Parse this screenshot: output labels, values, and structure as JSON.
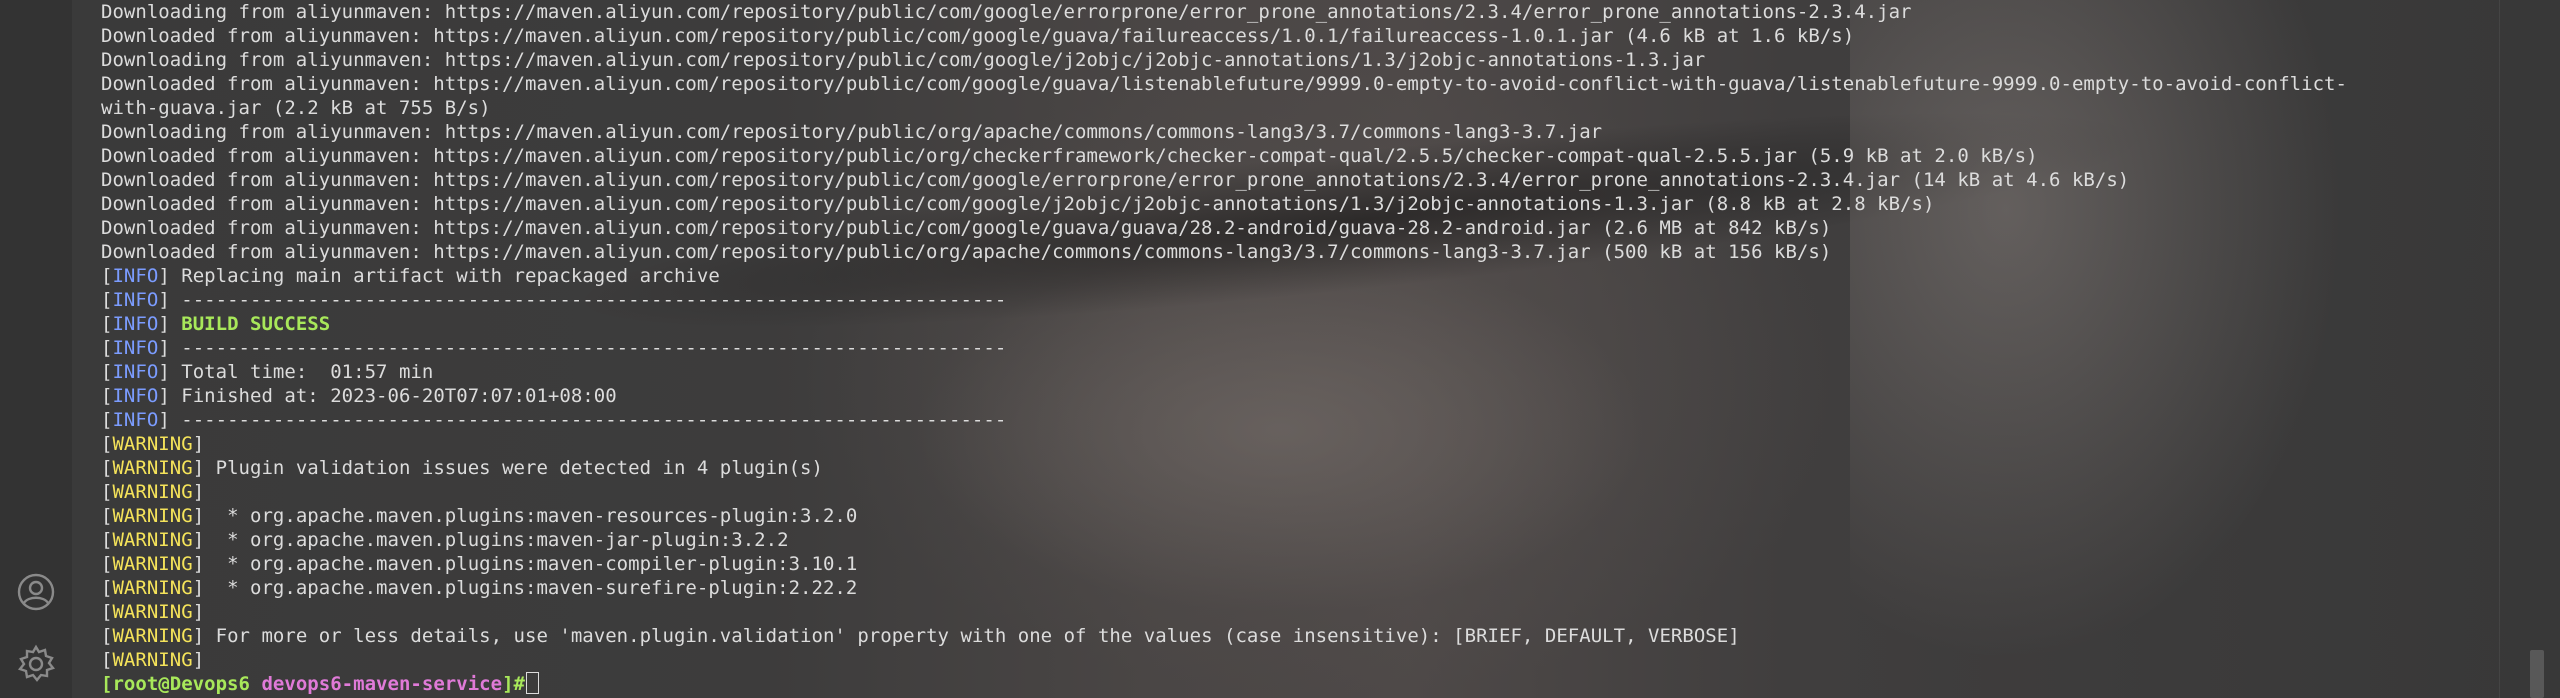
{
  "theme": {
    "info_color": "#7b9cff",
    "warning_color": "#f5e35a",
    "success_color": "#a8e85a",
    "path_color": "#e07ad8",
    "text_color": "#dcdcdc"
  },
  "sidebar": {
    "icons": [
      {
        "name": "user-icon"
      },
      {
        "name": "gear-icon"
      }
    ]
  },
  "terminal": {
    "download_lines": [
      "Downloading from aliyunmaven: https://maven.aliyun.com/repository/public/com/google/errorprone/error_prone_annotations/2.3.4/error_prone_annotations-2.3.4.jar",
      "Downloaded from aliyunmaven: https://maven.aliyun.com/repository/public/com/google/guava/failureaccess/1.0.1/failureaccess-1.0.1.jar (4.6 kB at 1.6 kB/s)",
      "Downloading from aliyunmaven: https://maven.aliyun.com/repository/public/com/google/j2objc/j2objc-annotations/1.3/j2objc-annotations-1.3.jar",
      "Downloaded from aliyunmaven: https://maven.aliyun.com/repository/public/com/google/guava/listenablefuture/9999.0-empty-to-avoid-conflict-with-guava/listenablefuture-9999.0-empty-to-avoid-conflict-",
      "with-guava.jar (2.2 kB at 755 B/s)",
      "Downloading from aliyunmaven: https://maven.aliyun.com/repository/public/org/apache/commons/commons-lang3/3.7/commons-lang3-3.7.jar",
      "Downloaded from aliyunmaven: https://maven.aliyun.com/repository/public/org/checkerframework/checker-compat-qual/2.5.5/checker-compat-qual-2.5.5.jar (5.9 kB at 2.0 kB/s)",
      "Downloaded from aliyunmaven: https://maven.aliyun.com/repository/public/com/google/errorprone/error_prone_annotations/2.3.4/error_prone_annotations-2.3.4.jar (14 kB at 4.6 kB/s)",
      "Downloaded from aliyunmaven: https://maven.aliyun.com/repository/public/com/google/j2objc/j2objc-annotations/1.3/j2objc-annotations-1.3.jar (8.8 kB at 2.8 kB/s)",
      "Downloaded from aliyunmaven: https://maven.aliyun.com/repository/public/com/google/guava/guava/28.2-android/guava-28.2-android.jar (2.6 MB at 842 kB/s)",
      "Downloaded from aliyunmaven: https://maven.aliyun.com/repository/public/org/apache/commons/commons-lang3/3.7/commons-lang3-3.7.jar (500 kB at 156 kB/s)"
    ],
    "info_tag": "INFO",
    "warning_tag": "WARNING",
    "info_lines": {
      "replacing": " Replacing main artifact with repackaged archive",
      "separator": " ------------------------------------------------------------------------",
      "build_success": "BUILD SUCCESS",
      "total_time": " Total time:  01:57 min",
      "finished_at": " Finished at: 2023-06-20T07:07:01+08:00"
    },
    "warning_lines": {
      "plugin_issues": " Plugin validation issues were detected in 4 plugin(s)",
      "plugin_1": "  * org.apache.maven.plugins:maven-resources-plugin:3.2.0",
      "plugin_2": "  * org.apache.maven.plugins:maven-jar-plugin:3.2.2",
      "plugin_3": "  * org.apache.maven.plugins:maven-compiler-plugin:3.10.1",
      "plugin_4": "  * org.apache.maven.plugins:maven-surefire-plugin:2.22.2",
      "details": " For more or less details, use 'maven.plugin.validation' property with one of the values (case insensitive): [BRIEF, DEFAULT, VERBOSE]"
    },
    "prompt": {
      "open": "[",
      "user_host": "root@Devops6",
      "space": " ",
      "dir": "devops6-maven-service",
      "close": "]#"
    }
  }
}
